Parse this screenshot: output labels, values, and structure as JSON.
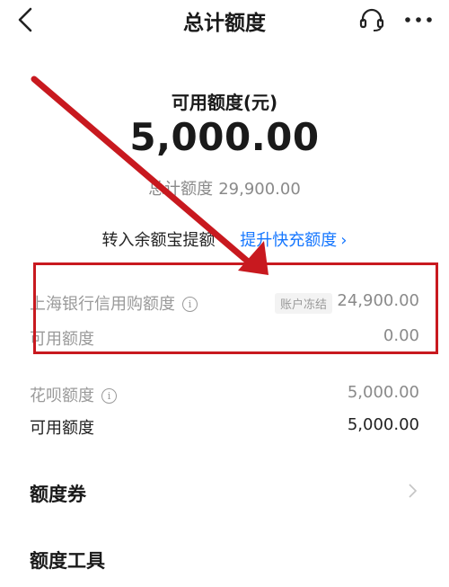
{
  "header": {
    "title": "总计额度"
  },
  "summary": {
    "available_label": "可用额度(元)",
    "available_amount": "5,000.00",
    "total_label": "总计额度",
    "total_amount": "29,900.00"
  },
  "actions": {
    "transfer_label": "转入余额宝提额",
    "boost_label": "提升快充额度"
  },
  "bank_credit": {
    "label": "上海银行信用购额度",
    "status_badge": "账户冻结",
    "amount": "24,900.00",
    "available_label": "可用额度",
    "available_amount": "0.00"
  },
  "huabei": {
    "label": "花呗额度",
    "amount": "5,000.00",
    "available_label": "可用额度",
    "available_amount": "5,000.00"
  },
  "sections": {
    "coupons_label": "额度券",
    "tools_label": "额度工具"
  },
  "colors": {
    "link": "#1677ff",
    "highlight": "#c8191f"
  }
}
